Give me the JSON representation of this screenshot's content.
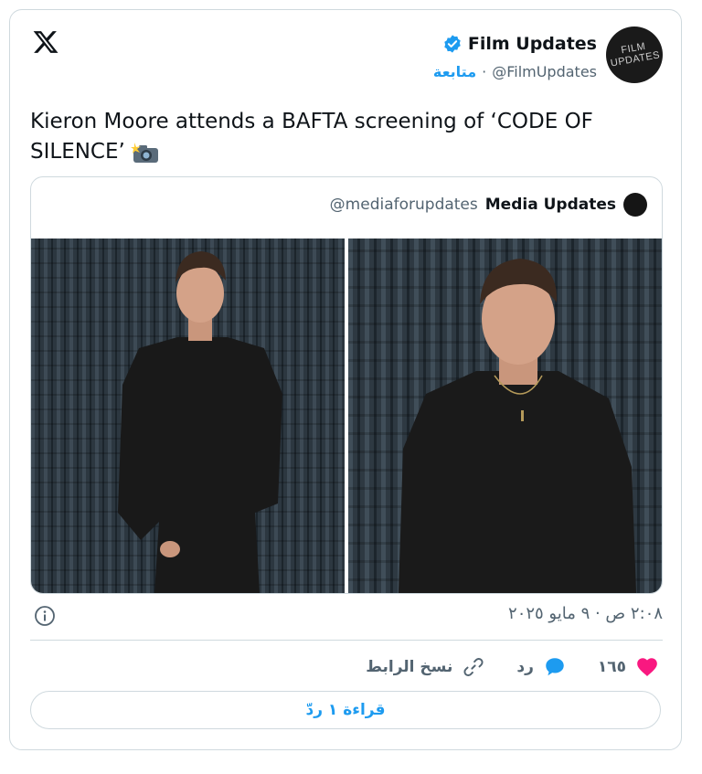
{
  "header": {
    "display_name": "Film Updates",
    "handle": "@FilmUpdates",
    "separator": "·",
    "follow_label": "متابعة",
    "avatar_text_line1": "FILM",
    "avatar_text_line2": "UPDATES"
  },
  "tweet": {
    "text": "Kieron Moore attends a BAFTA screening of ‘CODE OF SILENCE’"
  },
  "quote": {
    "display_name": "Media Updates",
    "handle": "@mediaforupdates"
  },
  "meta": {
    "timestamp": "٢:٠٨ ص · ٩ مايو ٢٠٢٥"
  },
  "actions": {
    "like_count": "١٦٥",
    "reply_label": "رد",
    "copy_link_label": "نسخ الرابط"
  },
  "read_replies_label": "قراءة ١ ردّ",
  "colors": {
    "accent": "#1d9bf0",
    "like": "#f91880",
    "text": "#0f1419",
    "muted": "#536471",
    "border": "#cfd9de"
  },
  "icons": [
    "x-logo-icon",
    "verified-badge-icon",
    "camera-flash-icon",
    "info-icon",
    "heart-icon",
    "reply-bubble-icon",
    "link-icon"
  ]
}
